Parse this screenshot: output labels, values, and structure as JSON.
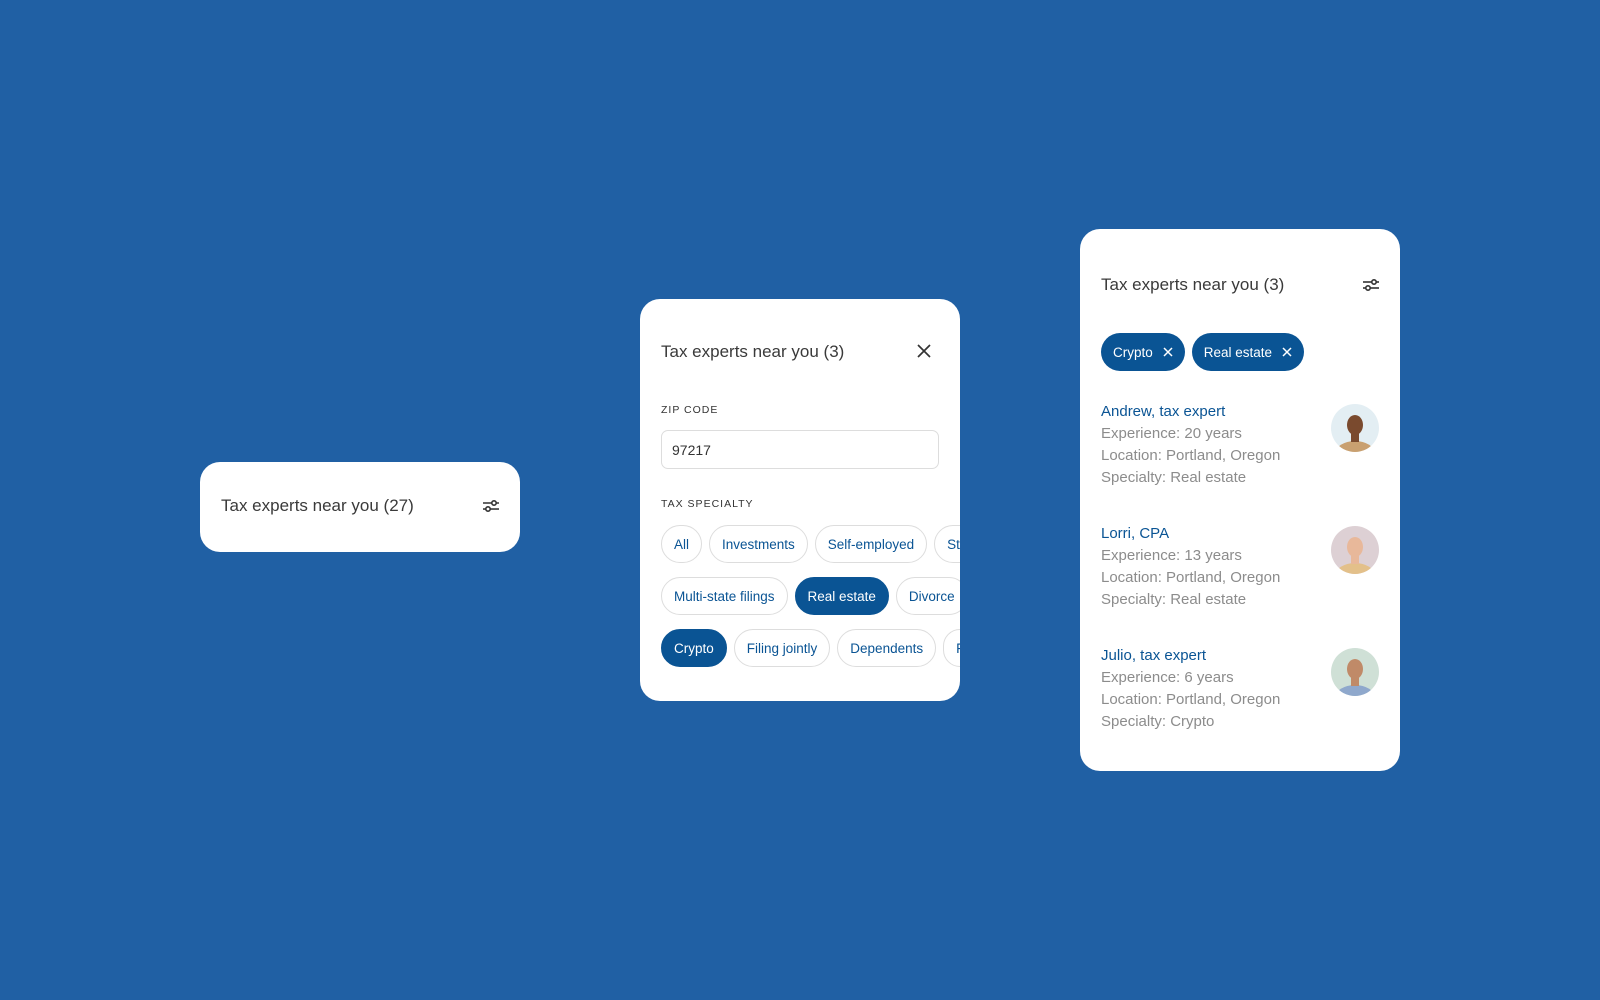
{
  "colors": {
    "background": "#2060a4",
    "accent": "#0a5494"
  },
  "collapsed_card": {
    "title": "Tax experts near you (27)",
    "icon": "filter-sliders-icon"
  },
  "filter_card": {
    "title": "Tax experts near you (3)",
    "close_icon": "close-icon",
    "zip_label": "ZIP CODE",
    "zip_value": "97217",
    "specialty_label": "TAX SPECIALTY",
    "chip_rows": [
      [
        {
          "label": "All",
          "selected": false
        },
        {
          "label": "Investments",
          "selected": false
        },
        {
          "label": "Self-employed",
          "selected": false
        },
        {
          "label": "Sto",
          "selected": false
        }
      ],
      [
        {
          "label": "Multi-state filings",
          "selected": false
        },
        {
          "label": "Real estate",
          "selected": true
        },
        {
          "label": "Divorce",
          "selected": false
        }
      ],
      [
        {
          "label": "Crypto",
          "selected": true
        },
        {
          "label": "Filing jointly",
          "selected": false
        },
        {
          "label": "Dependents",
          "selected": false
        },
        {
          "label": "F",
          "selected": false
        }
      ]
    ]
  },
  "results_card": {
    "title": "Tax experts near you (3)",
    "icon": "filter-sliders-icon",
    "active_filters": [
      "Crypto",
      "Real estate"
    ],
    "experts": [
      {
        "name": "Andrew, tax expert",
        "experience": "Experience: 20 years",
        "location": "Location: Portland, Oregon",
        "specialty": "Specialty: Real estate",
        "avatar_bg": "#e3eef3",
        "skin": "#7a4a2e",
        "shirt": "#c9a070"
      },
      {
        "name": "Lorri, CPA",
        "experience": "Experience: 13 years",
        "location": "Location: Portland, Oregon",
        "specialty": "Specialty: Real estate",
        "avatar_bg": "#ddd0d4",
        "skin": "#e8b89a",
        "shirt": "#e3c08a"
      },
      {
        "name": "Julio, tax expert",
        "experience": "Experience: 6 years",
        "location": "Location: Portland, Oregon",
        "specialty": "Specialty: Crypto",
        "avatar_bg": "#cfe0d6",
        "skin": "#c08a68",
        "shirt": "#8fa8cc"
      }
    ]
  }
}
